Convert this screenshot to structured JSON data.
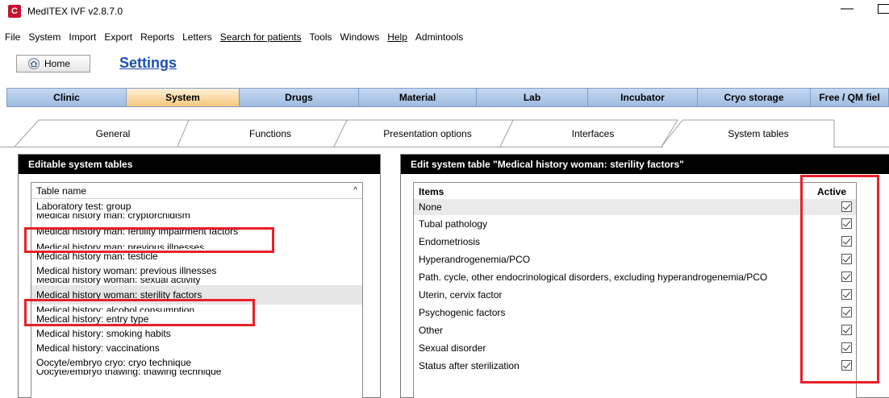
{
  "window": {
    "title": "MedITEX IVF v2.8.7.0",
    "app_icon_glyph": "C",
    "min_glyph": "—"
  },
  "menu": [
    {
      "label": "File"
    },
    {
      "label": "System"
    },
    {
      "label": "Import"
    },
    {
      "label": "Export"
    },
    {
      "label": "Reports"
    },
    {
      "label": "Letters"
    },
    {
      "label": "Search for patients"
    },
    {
      "label": "Tools"
    },
    {
      "label": "Windows"
    },
    {
      "label": "Help"
    },
    {
      "label": "Admintools"
    }
  ],
  "home_button": {
    "label": "Home",
    "icon": "house-icon"
  },
  "page_title": "Settings",
  "main_tabs": [
    {
      "label": "Clinic"
    },
    {
      "label": "System"
    },
    {
      "label": "Drugs"
    },
    {
      "label": "Material"
    },
    {
      "label": "Lab"
    },
    {
      "label": "Incubator"
    },
    {
      "label": "Cryo storage"
    },
    {
      "label": "Free / QM fiel"
    }
  ],
  "sub_tabs": [
    {
      "label": "General"
    },
    {
      "label": "Functions"
    },
    {
      "label": "Presentation options"
    },
    {
      "label": "Interfaces"
    },
    {
      "label": "System tables"
    }
  ],
  "left_panel": {
    "header": "Editable system tables",
    "column_header": "Table name",
    "sort_icon": "^",
    "rows": [
      "Laboratory test: group",
      "Medical history man: cryptorchidism",
      "Medical history man: fertility impairment factors",
      "Medical history man: previous illnesses",
      "Medical history man: testicle",
      "Medical history woman: previous illnesses",
      "Medical history woman: sexual activity",
      "Medical history woman: sterility factors",
      "Medical history: alcohol consumption",
      "Medical history: entry type",
      "Medical history: smoking habits",
      "Medical history: vaccinations",
      "Oocyte/embryo cryo: cryo technique",
      "Oocyte/embryo thawing: thawing technique"
    ]
  },
  "right_panel": {
    "header": "Edit system table \"Medical history woman: sterility factors\"",
    "col_items": "Items",
    "col_active": "Active",
    "rows": [
      "None",
      "Tubal pathology",
      "Endometriosis",
      "Hyperandrogenemia/PCO",
      "Path. cycle, other endocrinological disorders, excluding hyperandrogenemia/PCO",
      "Uterin, cervix factor",
      "Psychogenic factors",
      "Other",
      "Sexual disorder",
      "Status after sterilization"
    ]
  },
  "colors": {
    "highlight_red": "#e8202a",
    "title_blue": "#1a4fb8",
    "active_tab": "#f7c77d",
    "tab_strip": "#9ebbe0"
  }
}
